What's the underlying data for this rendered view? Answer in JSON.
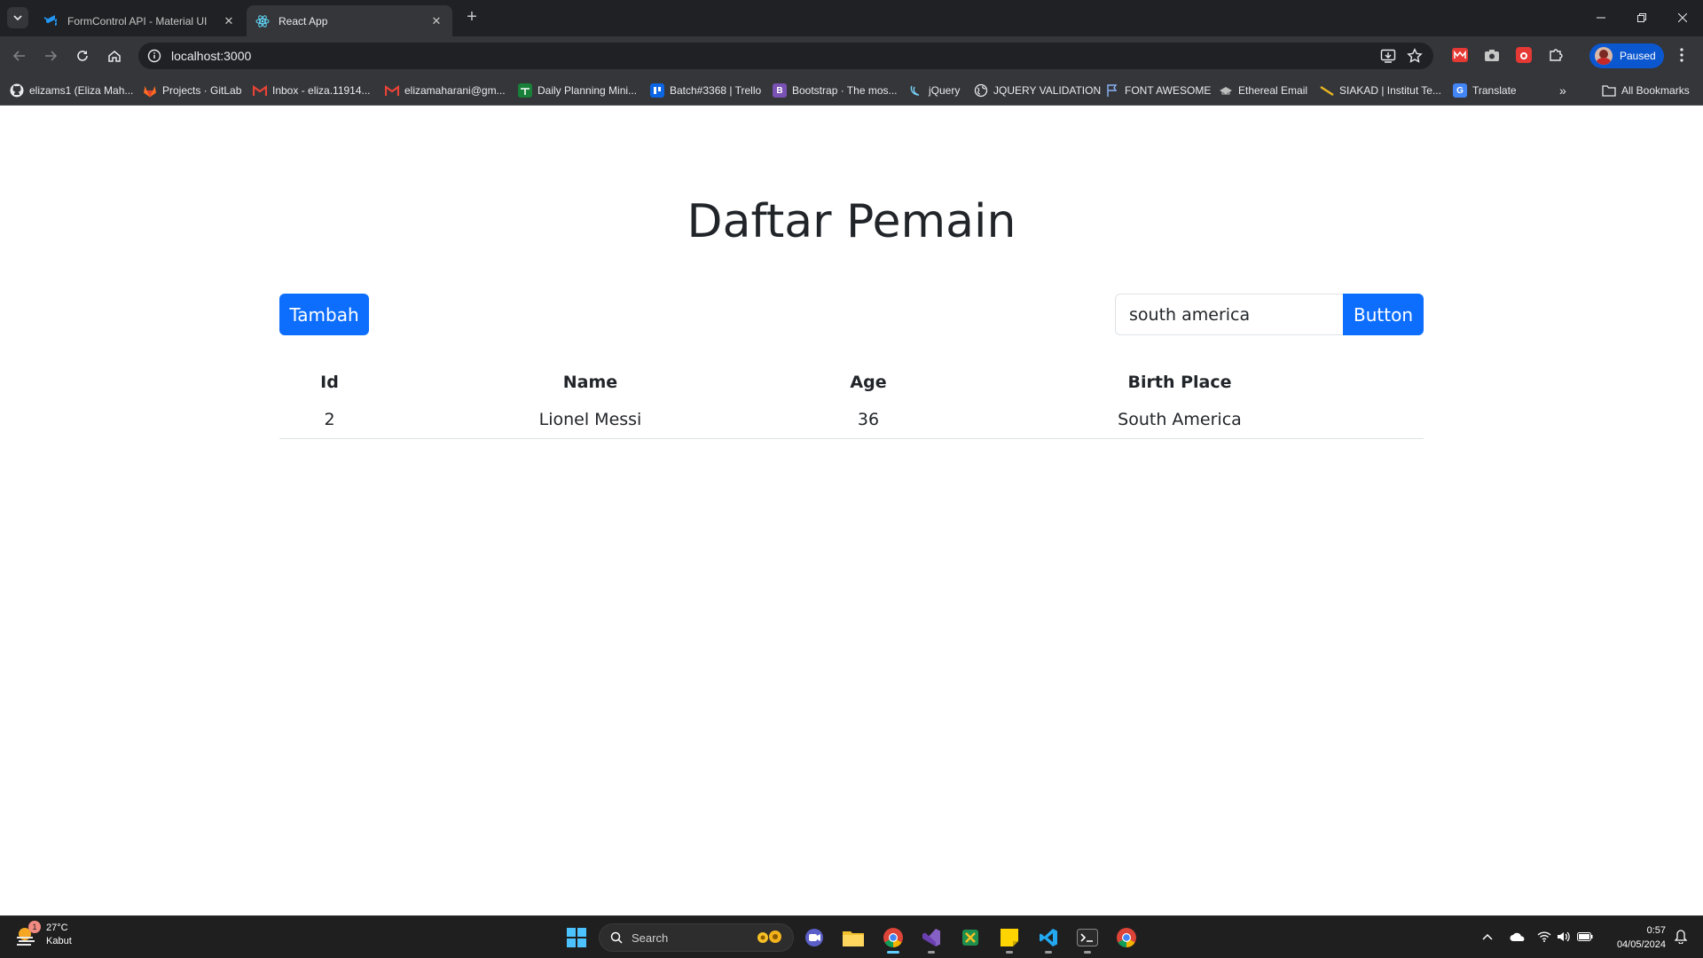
{
  "browser": {
    "tabs": [
      {
        "title": "FormControl API - Material UI",
        "icon": "mui-logo-icon",
        "active": false
      },
      {
        "title": "React App",
        "icon": "react-logo-icon",
        "active": true
      }
    ],
    "url": "localhost:3000",
    "profile_label": "Paused",
    "bookmarks": [
      {
        "label": "elizams1 (Eliza Mah...",
        "icon": "github-icon"
      },
      {
        "label": "Projects · GitLab",
        "icon": "gitlab-icon"
      },
      {
        "label": "Inbox - eliza.11914...",
        "icon": "gmail-icon"
      },
      {
        "label": "elizamaharani@gm...",
        "icon": "gmail-icon"
      },
      {
        "label": "Daily Planning Mini...",
        "icon": "sheets-icon"
      },
      {
        "label": "Batch#3368 | Trello",
        "icon": "trello-icon"
      },
      {
        "label": "Bootstrap · The mos...",
        "icon": "bootstrap-icon"
      },
      {
        "label": "jQuery",
        "icon": "jquery-icon"
      },
      {
        "label": "JQUERY VALIDATION",
        "icon": "globe-icon"
      },
      {
        "label": "FONT AWESOME",
        "icon": "flag-icon"
      },
      {
        "label": "Ethereal Email",
        "icon": "ethereal-icon"
      },
      {
        "label": "SIAKAD | Institut Te...",
        "icon": "siakad-icon"
      },
      {
        "label": "Translate",
        "icon": "translate-icon"
      }
    ],
    "all_bookmarks_label": "All Bookmarks"
  },
  "page": {
    "title": "Daftar Pemain",
    "add_button": "Tambah",
    "search": {
      "value": "south america",
      "button": "Button"
    },
    "table": {
      "headers": [
        "Id",
        "Name",
        "Age",
        "Birth Place"
      ],
      "rows": [
        [
          "2",
          "Lionel Messi",
          "36",
          "South America"
        ]
      ]
    }
  },
  "taskbar": {
    "weather": {
      "temp": "27°C",
      "condition": "Kabut",
      "badge": "1"
    },
    "search_label": "Search",
    "time": "0:57",
    "date": "04/05/2024"
  },
  "colors": {
    "primary": "#0d6efd",
    "chrome_dark": "#202124",
    "chrome_toolbar": "#35363a"
  }
}
